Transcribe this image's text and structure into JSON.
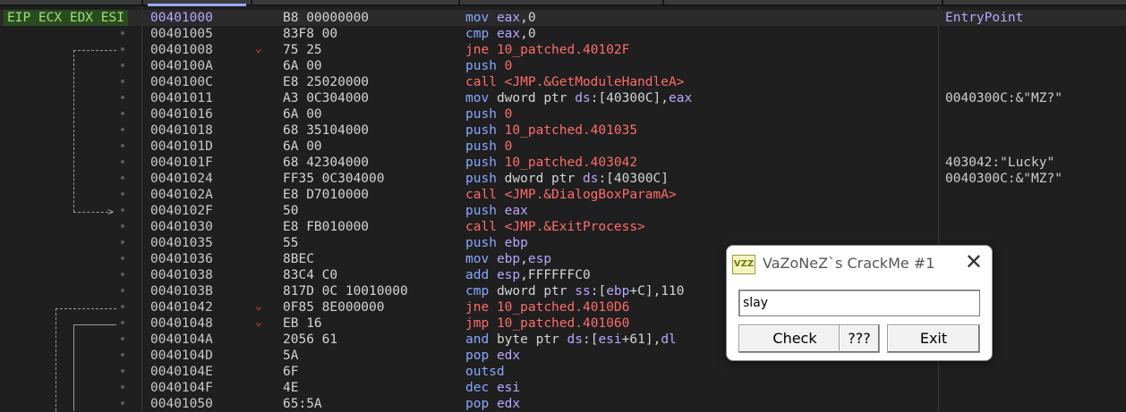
{
  "eip_tag": "EIP ECX EDX ESI",
  "rows": [
    {
      "addr": "00401000",
      "bytes": "B8 00000000",
      "mn": "mov",
      "ops": [
        {
          "t": "eax",
          "c": "reg"
        },
        {
          "t": ",0",
          "c": "num"
        }
      ],
      "comment": "EntryPoint",
      "comment_kind": "label",
      "eip": true
    },
    {
      "addr": "00401005",
      "bytes": "83F8 00",
      "mn": "cmp",
      "ops": [
        {
          "t": "eax",
          "c": "reg"
        },
        {
          "t": ",0",
          "c": "num"
        }
      ],
      "comment": ""
    },
    {
      "addr": "00401008",
      "bytes": "75 25",
      "mn": "jne",
      "ops": [
        {
          "t": "10_patched.40102F",
          "c": "addr"
        }
      ],
      "comment": "",
      "jmp": true
    },
    {
      "addr": "0040100A",
      "bytes": "6A 00",
      "mn": "push",
      "ops": [
        {
          "t": "0",
          "c": "addr"
        }
      ],
      "comment": ""
    },
    {
      "addr": "0040100C",
      "bytes": "E8 25020000",
      "mn": "call",
      "ops": [
        {
          "t": "<JMP.&GetModuleHandleA>",
          "c": "addr"
        }
      ],
      "comment": ""
    },
    {
      "addr": "00401011",
      "bytes": "A3 0C304000",
      "mn": "mov",
      "ops": [
        {
          "t": "dword ptr ",
          "c": "mem"
        },
        {
          "t": "ds",
          "c": "seg"
        },
        {
          "t": ":[40300C],",
          "c": "mem"
        },
        {
          "t": "eax",
          "c": "reg"
        }
      ],
      "comment": "0040300C:&\"MZ?\""
    },
    {
      "addr": "00401016",
      "bytes": "6A 00",
      "mn": "push",
      "ops": [
        {
          "t": "0",
          "c": "addr"
        }
      ],
      "comment": ""
    },
    {
      "addr": "00401018",
      "bytes": "68 35104000",
      "mn": "push",
      "ops": [
        {
          "t": "10_patched.401035",
          "c": "addr"
        }
      ],
      "comment": ""
    },
    {
      "addr": "0040101D",
      "bytes": "6A 00",
      "mn": "push",
      "ops": [
        {
          "t": "0",
          "c": "addr"
        }
      ],
      "comment": ""
    },
    {
      "addr": "0040101F",
      "bytes": "68 42304000",
      "mn": "push",
      "ops": [
        {
          "t": "10_patched.403042",
          "c": "addr"
        }
      ],
      "comment": "403042:\"Lucky\""
    },
    {
      "addr": "00401024",
      "bytes": "FF35 0C304000",
      "mn": "push",
      "ops": [
        {
          "t": "dword ptr ",
          "c": "mem"
        },
        {
          "t": "ds",
          "c": "seg"
        },
        {
          "t": ":[40300C]",
          "c": "mem"
        }
      ],
      "comment": "0040300C:&\"MZ?\""
    },
    {
      "addr": "0040102A",
      "bytes": "E8 D7010000",
      "mn": "call",
      "ops": [
        {
          "t": "<JMP.&DialogBoxParamA>",
          "c": "addr"
        }
      ],
      "comment": ""
    },
    {
      "addr": "0040102F",
      "bytes": "50",
      "mn": "push",
      "ops": [
        {
          "t": "eax",
          "c": "reg"
        }
      ],
      "comment": ""
    },
    {
      "addr": "00401030",
      "bytes": "E8 FB010000",
      "mn": "call",
      "ops": [
        {
          "t": "<JMP.&ExitProcess>",
          "c": "addr"
        }
      ],
      "comment": ""
    },
    {
      "addr": "00401035",
      "bytes": "55",
      "mn": "push",
      "ops": [
        {
          "t": "ebp",
          "c": "reg"
        }
      ],
      "comment": ""
    },
    {
      "addr": "00401036",
      "bytes": "8BEC",
      "mn": "mov",
      "ops": [
        {
          "t": "ebp",
          "c": "reg"
        },
        {
          "t": ",",
          "c": "num"
        },
        {
          "t": "esp",
          "c": "reg"
        }
      ],
      "comment": ""
    },
    {
      "addr": "00401038",
      "bytes": "83C4 C0",
      "mn": "add",
      "ops": [
        {
          "t": "esp",
          "c": "reg"
        },
        {
          "t": ",FFFFFFC0",
          "c": "num"
        }
      ],
      "comment": ""
    },
    {
      "addr": "0040103B",
      "bytes": "817D 0C 10010000",
      "mn": "cmp",
      "ops": [
        {
          "t": "dword ptr ",
          "c": "mem"
        },
        {
          "t": "ss",
          "c": "seg"
        },
        {
          "t": ":[",
          "c": "mem"
        },
        {
          "t": "ebp",
          "c": "reg"
        },
        {
          "t": "+C],110",
          "c": "mem"
        }
      ],
      "comment": ""
    },
    {
      "addr": "00401042",
      "bytes": "0F85 8E000000",
      "mn": "jne",
      "ops": [
        {
          "t": "10_patched.4010D6",
          "c": "addr"
        }
      ],
      "comment": "",
      "jmp": true
    },
    {
      "addr": "00401048",
      "bytes": "EB 16",
      "mn": "jmp",
      "ops": [
        {
          "t": "10_patched.401060",
          "c": "addr"
        }
      ],
      "comment": "",
      "jmp": true
    },
    {
      "addr": "0040104A",
      "bytes": "2056 61",
      "mn": "and",
      "ops": [
        {
          "t": "byte ptr ",
          "c": "mem"
        },
        {
          "t": "ds",
          "c": "seg"
        },
        {
          "t": ":[",
          "c": "mem"
        },
        {
          "t": "esi",
          "c": "reg"
        },
        {
          "t": "+61],",
          "c": "mem"
        },
        {
          "t": "dl",
          "c": "reg"
        }
      ],
      "comment": ""
    },
    {
      "addr": "0040104D",
      "bytes": "5A",
      "mn": "pop",
      "ops": [
        {
          "t": "edx",
          "c": "reg"
        }
      ],
      "comment": ""
    },
    {
      "addr": "0040104E",
      "bytes": "6F",
      "mn": "outsd",
      "ops": [],
      "comment": ""
    },
    {
      "addr": "0040104F",
      "bytes": "4E",
      "mn": "dec",
      "ops": [
        {
          "t": "esi",
          "c": "reg"
        }
      ],
      "comment": ""
    },
    {
      "addr": "00401050",
      "bytes": "65:5A",
      "mn": "pop",
      "ops": [
        {
          "t": "edx",
          "c": "reg"
        }
      ],
      "comment": ""
    }
  ],
  "dialog": {
    "icon_text": "VZZ",
    "title": "VaZoNeZ`s CrackMe #1",
    "close": "✕",
    "input_value": "slay",
    "buttons": {
      "check": "Check",
      "qqq": "???",
      "exit": "Exit"
    }
  },
  "colors": {
    "eip_bg": "#2a4a20",
    "mnemonic": "#8aa7ff",
    "branch": "#ff6b6b",
    "register": "#b9a7ff"
  }
}
